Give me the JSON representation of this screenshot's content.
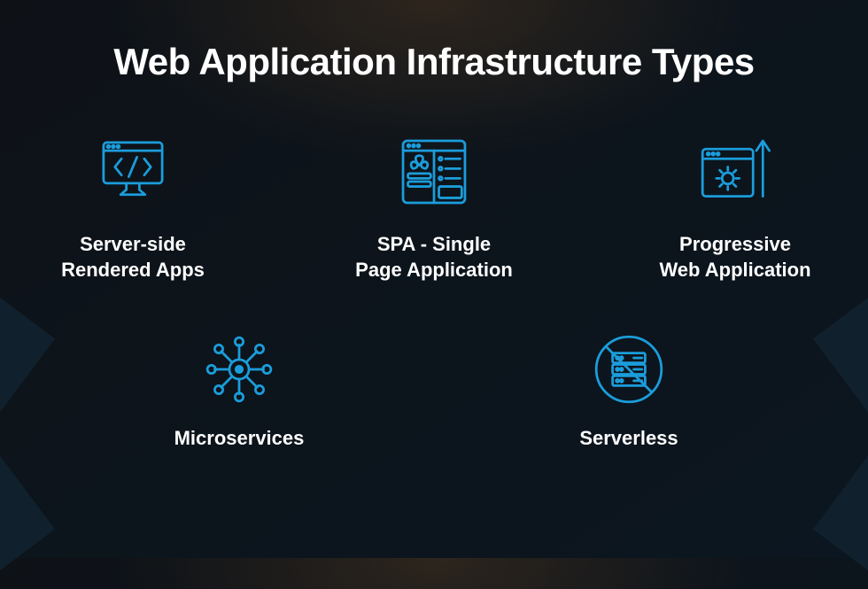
{
  "title": "Web Application Infrastructure Types",
  "accent": "#1b9ddb",
  "items": {
    "ssr": {
      "label": "Server-side\nRendered Apps"
    },
    "spa": {
      "label": "SPA - Single\nPage Application"
    },
    "pwa": {
      "label": "Progressive\nWeb Application"
    },
    "micro": {
      "label": "Microservices"
    },
    "serverless": {
      "label": "Serverless"
    }
  }
}
